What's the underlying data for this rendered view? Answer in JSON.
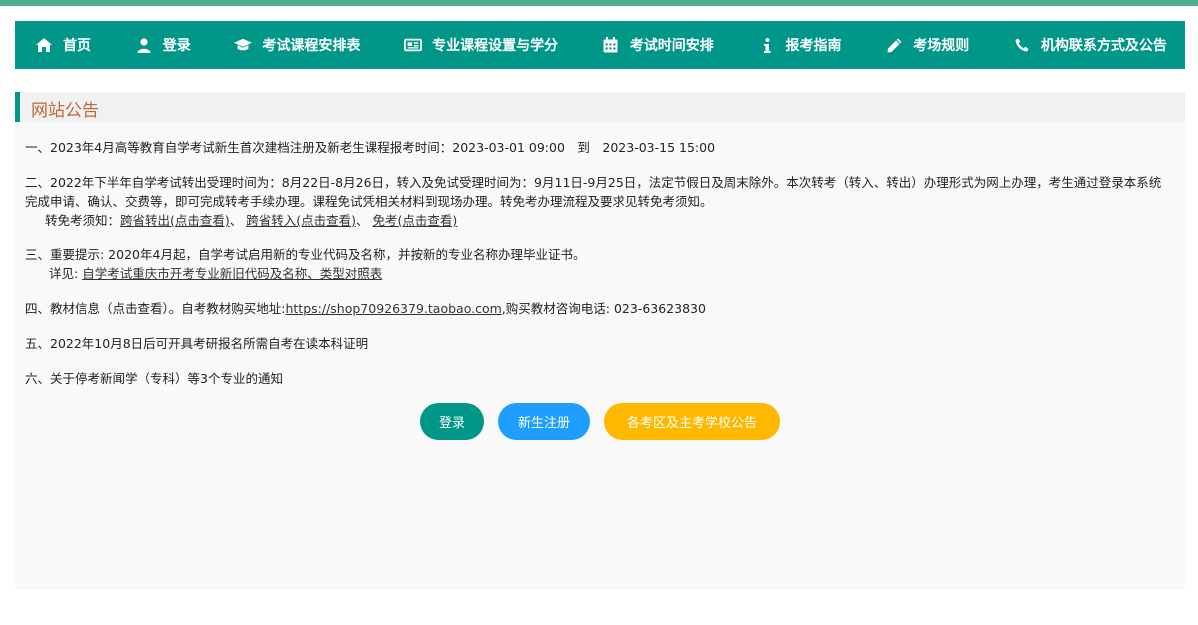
{
  "colors": {
    "nav_bg": "#009688",
    "accent_title": "#c0653c",
    "btn_login": "#009688",
    "btn_register": "#1e9fff",
    "btn_notice": "#ffb800"
  },
  "nav": [
    {
      "label": "首页",
      "icon": "home-icon"
    },
    {
      "label": "登录",
      "icon": "user-icon"
    },
    {
      "label": "考试课程安排表",
      "icon": "graduation-cap-icon"
    },
    {
      "label": "专业课程设置与学分",
      "icon": "newspaper-icon"
    },
    {
      "label": "考试时间安排",
      "icon": "calendar-icon"
    },
    {
      "label": "报考指南",
      "icon": "info-icon"
    },
    {
      "label": "考场规则",
      "icon": "pencil-icon"
    },
    {
      "label": "机构联系方式及公告",
      "icon": "phone-icon"
    }
  ],
  "panel": {
    "title": "网站公告"
  },
  "notices": {
    "n1": "一、2023年4月高等教育自学考试新生首次建档注册及新老生课程报考时间：2023-03-01 09:00　到　2023-03-15 15:00",
    "n2": "二、2022年下半年自学考试转出受理时间为：8月22日-8月26日，转入及免试受理时间为：9月11日-9月25日，法定节假日及周末除外。本次转考（转入、转出）办理形式为网上办理，考生通过登录本系统完成申请、确认、交费等，即可完成转考手续办理。课程免试凭相关材料到现场办理。转免考办理流程及要求见转免考须知。",
    "n2_sub_label": "转免考须知：",
    "n2_link1": "跨省转出(点击查看)",
    "n2_sep1": "、",
    "n2_link2": "跨省转入(点击查看)",
    "n2_sep2": "、",
    "n2_link3": "免考(点击查看)",
    "n3": "三、重要提示: 2020年4月起，自学考试启用新的专业代码及名称，并按新的专业名称办理毕业证书。",
    "n3_sub_label": "详见: ",
    "n3_link": "自学考试重庆市开考专业新旧代码及名称、类型对照表",
    "n4_pre": "四、教材信息（点击查看）。自考教材购买地址:",
    "n4_link": "https://shop70926379.taobao.com",
    "n4_post": ",购买教材咨询电话:  023-63623830",
    "n5": "五、2022年10月8日后可开具考研报名所需自考在读本科证明",
    "n6": "六、关于停考新闻学（专科）等3个专业的通知"
  },
  "buttons": {
    "login": "登录",
    "register": "新生注册",
    "notice": "各考区及主考学校公告"
  }
}
